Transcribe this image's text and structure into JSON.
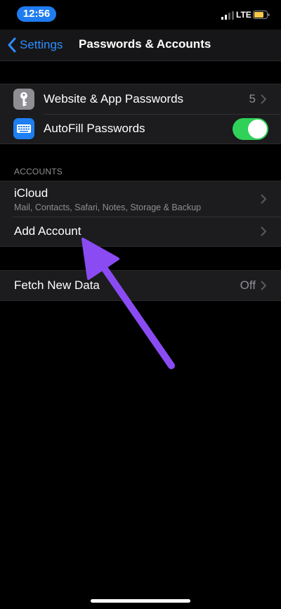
{
  "status_bar": {
    "time": "12:56",
    "network": "LTE",
    "signal_icon": "cellular-signal-icon",
    "battery_icon": "battery-icon",
    "battery_color": "#f7c948"
  },
  "nav": {
    "back_label": "Settings",
    "title": "Passwords & Accounts",
    "accent": "#2f8dff"
  },
  "passwords_group": {
    "website_passwords": {
      "label": "Website & App Passwords",
      "value": "5",
      "icon": "key-icon"
    },
    "autofill": {
      "label": "AutoFill Passwords",
      "icon": "keyboard-icon",
      "toggle_on": true,
      "toggle_color": "#30d158"
    }
  },
  "accounts": {
    "header": "ACCOUNTS",
    "icloud": {
      "label": "iCloud",
      "subtitle": "Mail, Contacts, Safari, Notes, Storage & Backup"
    },
    "add_account": {
      "label": "Add Account"
    }
  },
  "fetch": {
    "label": "Fetch New Data",
    "value": "Off"
  },
  "annotation": {
    "arrow_color": "#8a4cf2"
  }
}
